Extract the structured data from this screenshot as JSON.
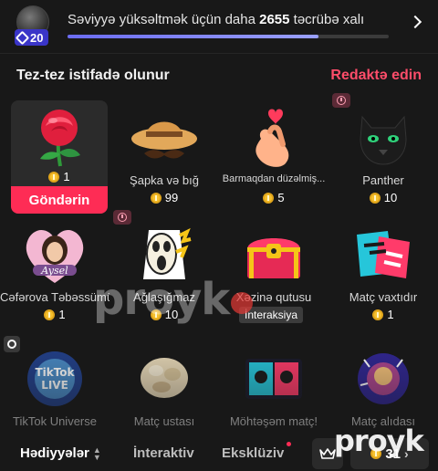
{
  "header": {
    "level": "20",
    "level_text_prefix": "Səviyyə yüksəltmək üçün daha",
    "xp_remaining": "2655",
    "level_text_suffix": "təcrübə xalı",
    "progress_fraction": 0.78
  },
  "section": {
    "title": "Tez-tez istifadə olunur",
    "edit_label": "Redaktə edin"
  },
  "gifts": [
    {
      "name": "",
      "price": "1",
      "icon": "rose-icon",
      "send_label": "Göndərin",
      "selected": true
    },
    {
      "name": "Şapka və bığ",
      "price": "99",
      "icon": "hat-mustache-icon"
    },
    {
      "name": "Barmaqdan düzəlmiş...",
      "price": "5",
      "icon": "finger-heart-icon"
    },
    {
      "name": "Panther",
      "price": "10",
      "icon": "panther-icon",
      "timer": true
    },
    {
      "name": "Cəfərova Təbəssümü",
      "price": "1",
      "icon": "aysel-sticker-icon"
    },
    {
      "name": "Ağlaşığmaz",
      "price": "10",
      "icon": "scream-sticker-icon",
      "timer": true
    },
    {
      "name": "Xəzinə qutusu",
      "tag": "İnteraksiya",
      "icon": "treasure-chest-icon"
    },
    {
      "name": "Matç vaxtıdır",
      "price": "1",
      "icon": "match-time-icon"
    },
    {
      "name": "TikTok Universe",
      "icon": "tiktok-universe-icon",
      "target": true
    },
    {
      "name": "Matç ustası",
      "icon": "match-master-icon"
    },
    {
      "name": "Möhtəşəm matç!",
      "icon": "great-match-icon"
    },
    {
      "name": "Matç alıdası",
      "icon": "match-aura-icon"
    }
  ],
  "bottom": {
    "tabs": [
      "Hədiyyələr",
      "İnteraktiv",
      "Eksklüziv"
    ],
    "balance": "31"
  },
  "watermark": "proyk"
}
